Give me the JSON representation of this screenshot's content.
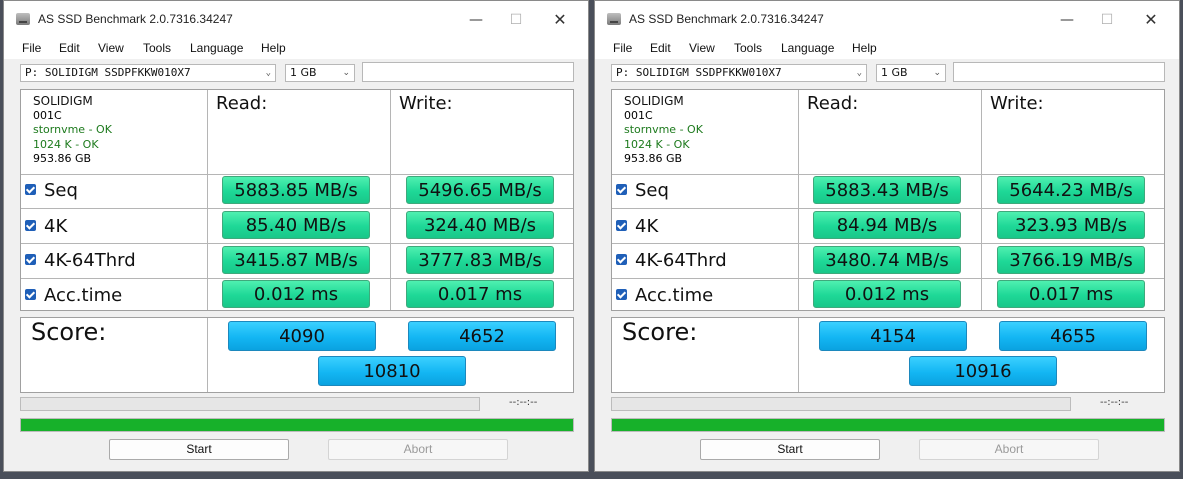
{
  "windows": [
    {
      "title": "AS SSD Benchmark 2.0.7316.34247",
      "menu": [
        "File",
        "Edit",
        "View",
        "Tools",
        "Language",
        "Help"
      ],
      "drive": "P: SOLIDIGM SSDPFKKW010X7",
      "size": "1 GB",
      "info": {
        "brand": "SOLIDIGM",
        "fw": "001C",
        "driver": "stornvme - OK",
        "align": "1024 K - OK",
        "capacity": "953.86 GB"
      },
      "read_label": "Read:",
      "write_label": "Write:",
      "rows": [
        {
          "label": "Seq",
          "read": "5883.85 MB/s",
          "write": "5496.65 MB/s"
        },
        {
          "label": "4K",
          "read": "85.40 MB/s",
          "write": "324.40 MB/s"
        },
        {
          "label": "4K-64Thrd",
          "read": "3415.87 MB/s",
          "write": "3777.83 MB/s"
        },
        {
          "label": "Acc.time",
          "read": "0.012 ms",
          "write": "0.017 ms"
        }
      ],
      "score_label": "Score:",
      "score_read": "4090",
      "score_write": "4652",
      "score_total": "10810",
      "time": "--:--:--",
      "progress": 1.0,
      "start": "Start",
      "abort": "Abort"
    },
    {
      "title": "AS SSD Benchmark 2.0.7316.34247",
      "menu": [
        "File",
        "Edit",
        "View",
        "Tools",
        "Language",
        "Help"
      ],
      "drive": "P: SOLIDIGM SSDPFKKW010X7",
      "size": "1 GB",
      "info": {
        "brand": "SOLIDIGM",
        "fw": "001C",
        "driver": "stornvme - OK",
        "align": "1024 K - OK",
        "capacity": "953.86 GB"
      },
      "read_label": "Read:",
      "write_label": "Write:",
      "rows": [
        {
          "label": "Seq",
          "read": "5883.43 MB/s",
          "write": "5644.23 MB/s"
        },
        {
          "label": "4K",
          "read": "84.94 MB/s",
          "write": "323.93 MB/s"
        },
        {
          "label": "4K-64Thrd",
          "read": "3480.74 MB/s",
          "write": "3766.19 MB/s"
        },
        {
          "label": "Acc.time",
          "read": "0.012 ms",
          "write": "0.017 ms"
        }
      ],
      "score_label": "Score:",
      "score_read": "4154",
      "score_write": "4655",
      "score_total": "10916",
      "time": "--:--:--",
      "progress": 1.0,
      "start": "Start",
      "abort": "Abort"
    }
  ]
}
